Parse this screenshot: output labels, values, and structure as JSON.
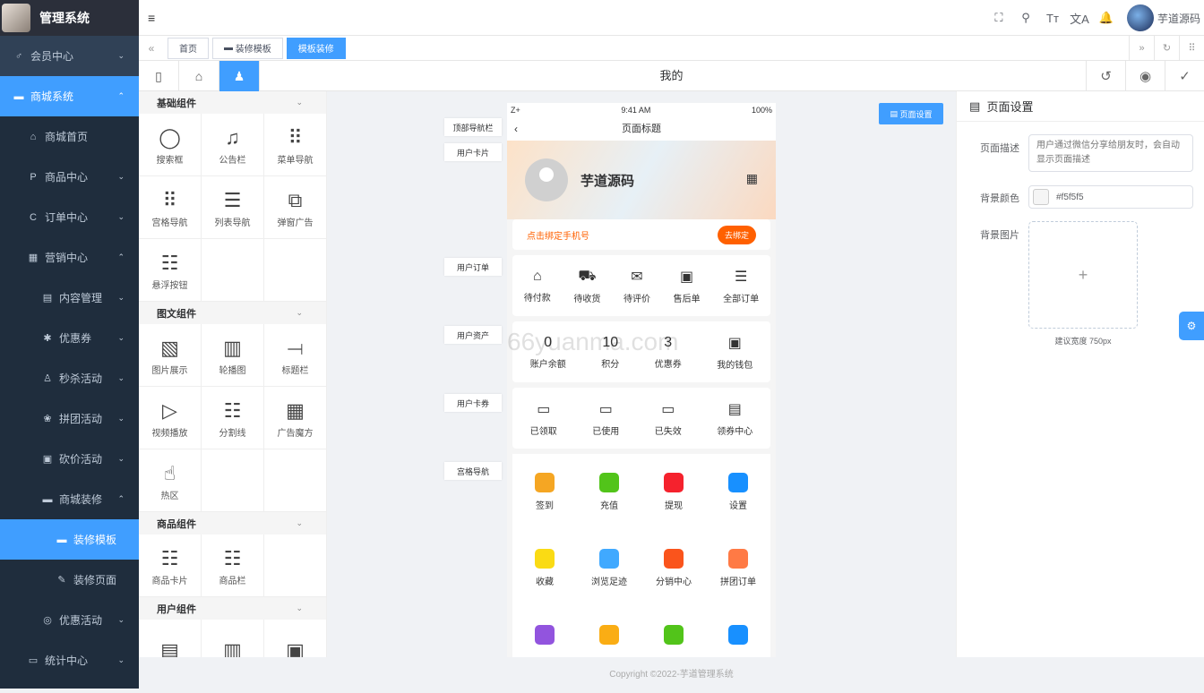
{
  "app": {
    "title": "管理系统"
  },
  "sidebar": [
    {
      "icon": "♂",
      "label": "会员中心",
      "chev": "⌄"
    },
    {
      "icon": "▬",
      "label": "商城系统",
      "chev": "⌃",
      "state": "open"
    },
    {
      "icon": "⌂",
      "label": "商城首页",
      "chev": "",
      "level": 1
    },
    {
      "icon": "P",
      "label": "商品中心",
      "chev": "⌄",
      "level": 1
    },
    {
      "icon": "C",
      "label": "订单中心",
      "chev": "⌄",
      "level": 1
    },
    {
      "icon": "▦",
      "label": "营销中心",
      "chev": "⌃",
      "level": 1
    },
    {
      "icon": "▤",
      "label": "内容管理",
      "chev": "⌄",
      "level": 2
    },
    {
      "icon": "✱",
      "label": "优惠券",
      "chev": "⌄",
      "level": 2
    },
    {
      "icon": "♙",
      "label": "秒杀活动",
      "chev": "⌄",
      "level": 2
    },
    {
      "icon": "❀",
      "label": "拼团活动",
      "chev": "⌄",
      "level": 2
    },
    {
      "icon": "▣",
      "label": "砍价活动",
      "chev": "⌄",
      "level": 2
    },
    {
      "icon": "▬",
      "label": "商城装修",
      "chev": "⌃",
      "level": 2
    },
    {
      "icon": "▬",
      "label": "装修模板",
      "chev": "",
      "level": 3,
      "state": "active"
    },
    {
      "icon": "✎",
      "label": "装修页面",
      "chev": "",
      "level": 3
    },
    {
      "icon": "◎",
      "label": "优惠活动",
      "chev": "⌄",
      "level": 2
    },
    {
      "icon": "▭",
      "label": "统计中心",
      "chev": "⌄",
      "level": 1
    }
  ],
  "topbar": {
    "menu_icon": "≡",
    "icons": [
      "⛶",
      "⚲",
      "Tт",
      "文A",
      "🔔"
    ],
    "user": "芋道源码"
  },
  "tags": {
    "home": "首页",
    "t1": "装修模板",
    "t2": "模板装修"
  },
  "toolbar": {
    "title": "我的"
  },
  "components": {
    "groups": [
      {
        "name": "基础组件",
        "items": [
          {
            "icon": "◯",
            "label": "搜索框"
          },
          {
            "icon": "♫",
            "label": "公告栏"
          },
          {
            "icon": "⠿",
            "label": "菜单导航"
          },
          {
            "icon": "⠿",
            "label": "宫格导航"
          },
          {
            "icon": "☰",
            "label": "列表导航"
          },
          {
            "icon": "⧉",
            "label": "弹窗广告"
          },
          {
            "icon": "☷",
            "label": "悬浮按钮"
          }
        ]
      },
      {
        "name": "图文组件",
        "items": [
          {
            "icon": "▧",
            "label": "图片展示"
          },
          {
            "icon": "▥",
            "label": "轮播图"
          },
          {
            "icon": "⟞",
            "label": "标题栏"
          },
          {
            "icon": "▷",
            "label": "视频播放"
          },
          {
            "icon": "☷",
            "label": "分割线"
          },
          {
            "icon": "▦",
            "label": "广告魔方"
          },
          {
            "icon": "☝",
            "label": "热区"
          }
        ]
      },
      {
        "name": "商品组件",
        "items": [
          {
            "icon": "☷",
            "label": "商品卡片"
          },
          {
            "icon": "☷",
            "label": "商品栏"
          }
        ]
      },
      {
        "name": "用户组件",
        "items": [
          {
            "icon": "▤",
            "label": ""
          },
          {
            "icon": "▥",
            "label": ""
          },
          {
            "icon": "▣",
            "label": ""
          }
        ]
      }
    ]
  },
  "phone": {
    "status": {
      "left": "Z+",
      "time": "9:41 AM",
      "right": "100%"
    },
    "nav_title": "页面标题",
    "user_name": "芋道源码",
    "bind": {
      "text": "点击绑定手机号",
      "btn": "去绑定"
    },
    "orders": [
      {
        "icon": "⌂",
        "label": "待付款"
      },
      {
        "icon": "⛟",
        "label": "待收货"
      },
      {
        "icon": "✉",
        "label": "待评价"
      },
      {
        "icon": "▣",
        "label": "售后单"
      },
      {
        "icon": "☰",
        "label": "全部订单"
      }
    ],
    "assets": [
      {
        "val": "0",
        "label": "账户余额"
      },
      {
        "val": "10",
        "label": "积分"
      },
      {
        "val": "3",
        "label": "优惠券"
      },
      {
        "val": "▣",
        "label": "我的钱包"
      }
    ],
    "coupons": [
      {
        "icon": "▭",
        "label": "已领取"
      },
      {
        "icon": "▭",
        "label": "已使用"
      },
      {
        "icon": "▭",
        "label": "已失效"
      },
      {
        "icon": "▤",
        "label": "领券中心"
      }
    ],
    "grid": [
      {
        "label": "签到",
        "color": "#f5a623"
      },
      {
        "label": "充值",
        "color": "#52c41a"
      },
      {
        "label": "提现",
        "color": "#f5222d"
      },
      {
        "label": "设置",
        "color": "#1890ff"
      },
      {
        "label": "收藏",
        "color": "#fadb14"
      },
      {
        "label": "浏览足迹",
        "color": "#40a9ff"
      },
      {
        "label": "分销中心",
        "color": "#fa541c"
      },
      {
        "label": "拼团订单",
        "color": "#ff7a45"
      },
      {
        "label": "",
        "color": "#9254de"
      },
      {
        "label": "",
        "color": "#faad14"
      },
      {
        "label": "",
        "color": "#52c41a"
      },
      {
        "label": "",
        "color": "#1890ff"
      }
    ]
  },
  "labels": [
    "顶部导航栏",
    "用户卡片",
    "用户订单",
    "用户资产",
    "用户卡券",
    "宫格导航"
  ],
  "page_settings_btn": "页面设置",
  "right": {
    "title": "页面设置",
    "desc_label": "页面描述",
    "desc_placeholder": "用户通过微信分享给朋友时，会自动显示页面描述",
    "bg_color_label": "背景颜色",
    "bg_color": "#f5f5f5",
    "bg_img_label": "背景图片",
    "tip": "建议宽度 750px"
  },
  "footer": "Copyright ©2022-芋道管理系统",
  "watermark": "66yuanma.com"
}
